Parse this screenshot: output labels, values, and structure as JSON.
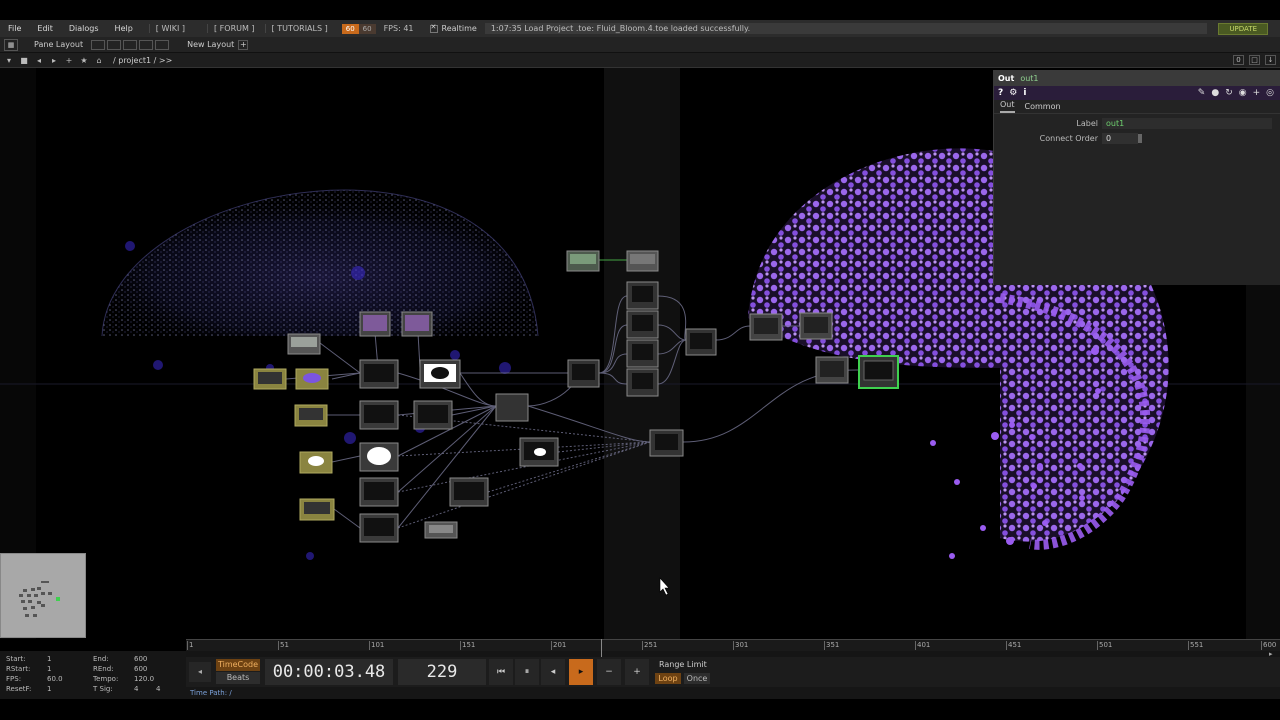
{
  "menu": {
    "items": [
      "File",
      "Edit",
      "Dialogs",
      "Help"
    ],
    "links": [
      "[ WIKI ]",
      "[ FORUM ]",
      "[ TUTORIALS ]"
    ],
    "fps_target": "60",
    "fps_alt": "60",
    "fps_label": "FPS:  41",
    "realtime_label": "Realtime",
    "status": "1:07:35 Load Project .toe: Fluid_Bloom.4.toe loaded successfully.",
    "update_label": "UPDATE"
  },
  "panebar": {
    "pane_layout": "Pane Layout",
    "new_layout": "New Layout",
    "plus": "+"
  },
  "navbar": {
    "path": "/  project1  /  >>",
    "counter": "0"
  },
  "params": {
    "op_type": "Out",
    "op_name": "out1",
    "icons": [
      "?",
      "i"
    ],
    "tabs": [
      "Out",
      "Common"
    ],
    "label_name": "Label",
    "label_value": "out1",
    "connect_name": "Connect Order",
    "connect_value": "0"
  },
  "timeline": {
    "ticks": [
      "1",
      "51",
      "101",
      "151",
      "201",
      "251",
      "301",
      "351",
      "401",
      "451",
      "501",
      "551",
      "600"
    ],
    "left_info": {
      "start_label": "Start:",
      "start_val": "1",
      "end_label": "End:",
      "end_val": "600",
      "rstart_label": "RStart:",
      "rstart_val": "1",
      "rend_label": "REnd:",
      "rend_val": "600",
      "fps_label": "FPS:",
      "fps_val": "60.0",
      "tempo_label": "Tempo:",
      "tempo_val": "120.0",
      "resetf_label": "ResetF:",
      "resetf_val": "1",
      "tsig_label": "T Sig:",
      "tsig_val1": "4",
      "tsig_val2": "4"
    },
    "timecode_label": "TimeCode",
    "beats_label": "Beats",
    "timecode": "00:00:03.48",
    "frame": "229",
    "range_limit": "Range Limit",
    "loop": "Loop",
    "once": "Once",
    "time_path": "Time Path: /",
    "playhead_frame": 229,
    "frame_range": [
      1,
      600
    ]
  },
  "colors": {
    "accent_orange": "#c86a1c",
    "node_selected": "#3fd04f",
    "particle_purple": "#9a5cf0",
    "param_value_green": "#6fd06f"
  }
}
